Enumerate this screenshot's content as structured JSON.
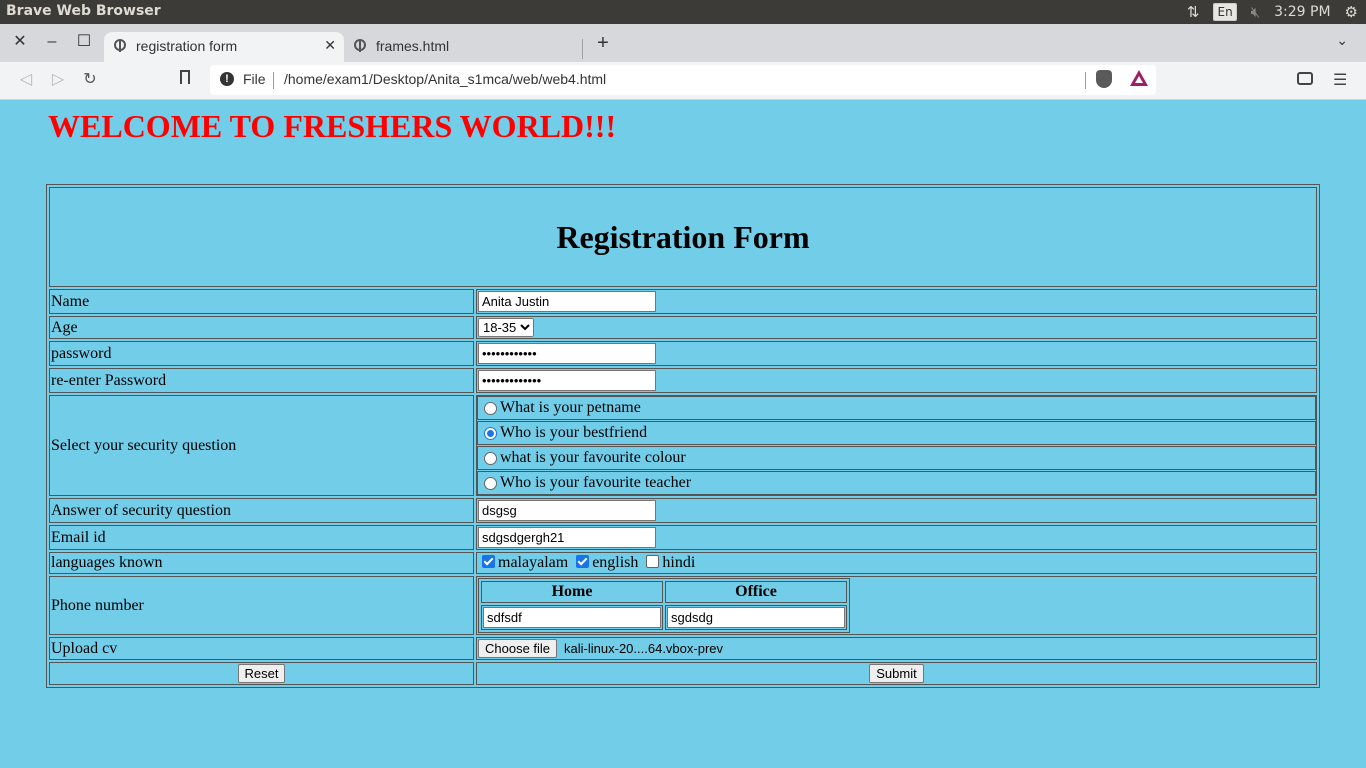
{
  "os": {
    "title": "Brave Web Browser",
    "lang": "En",
    "time": "3:29 PM"
  },
  "browser": {
    "tabs": [
      {
        "label": "registration form",
        "active": true
      },
      {
        "label": "frames.html",
        "active": false
      }
    ],
    "url_scheme": "File",
    "url": "/home/exam1/Desktop/Anita_s1mca/web/web4.html"
  },
  "page": {
    "welcome": "WELCOME TO FRESHERS WORLD!!!",
    "form_title": "Registration Form",
    "labels": {
      "name": "Name",
      "age": "Age",
      "password": "password",
      "reenter": "re-enter Password",
      "security_question": "Select your security question",
      "answer": "Answer of security question",
      "email": "Email id",
      "languages": "languages known",
      "phone": "Phone number",
      "upload": "Upload cv"
    },
    "values": {
      "name": "Anita Justin",
      "age": "18-35",
      "password": "••••••••••••",
      "reenter": "•••••••••••••",
      "answer": "dsgsg",
      "email": "sdgsdgergh21",
      "phone_home": "sdfsdf",
      "phone_office": "sgdsdg",
      "file_name": "kali-linux-20....64.vbox-prev"
    },
    "security_options": [
      {
        "label": "What is your petname",
        "checked": false
      },
      {
        "label": "Who is your bestfriend",
        "checked": true
      },
      {
        "label": "what is your favourite colour",
        "checked": false
      },
      {
        "label": "Who is your favourite teacher",
        "checked": false
      }
    ],
    "languages": [
      {
        "label": "malayalam",
        "checked": true
      },
      {
        "label": "english",
        "checked": true
      },
      {
        "label": "hindi",
        "checked": false
      }
    ],
    "phone_headers": {
      "home": "Home",
      "office": "Office"
    },
    "buttons": {
      "choose_file": "Choose file",
      "reset": "Reset",
      "submit": "Submit"
    }
  },
  "colors": {
    "page_bg": "#72cde9",
    "welcome": "#ff0000"
  }
}
